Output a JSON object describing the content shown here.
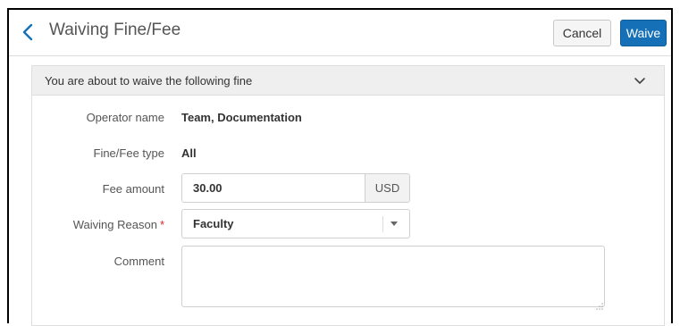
{
  "header": {
    "title": "Waiving Fine/Fee",
    "cancel_label": "Cancel",
    "waive_label": "Waive",
    "back_icon": "chevron-left-icon"
  },
  "panel": {
    "title": "You are about to waive the following fine",
    "toggle_icon": "chevron-down-icon"
  },
  "form": {
    "operator_label": "Operator name",
    "operator_value": "Team, Documentation",
    "type_label": "Fine/Fee type",
    "type_value": "All",
    "fee_label": "Fee amount",
    "fee_value": "30.00",
    "fee_currency": "USD",
    "reason_label": "Waiving Reason",
    "reason_required_mark": "*",
    "reason_value": "Faculty",
    "comment_label": "Comment",
    "comment_value": ""
  },
  "colors": {
    "primary": "#1570b8",
    "required": "#d9232d"
  }
}
